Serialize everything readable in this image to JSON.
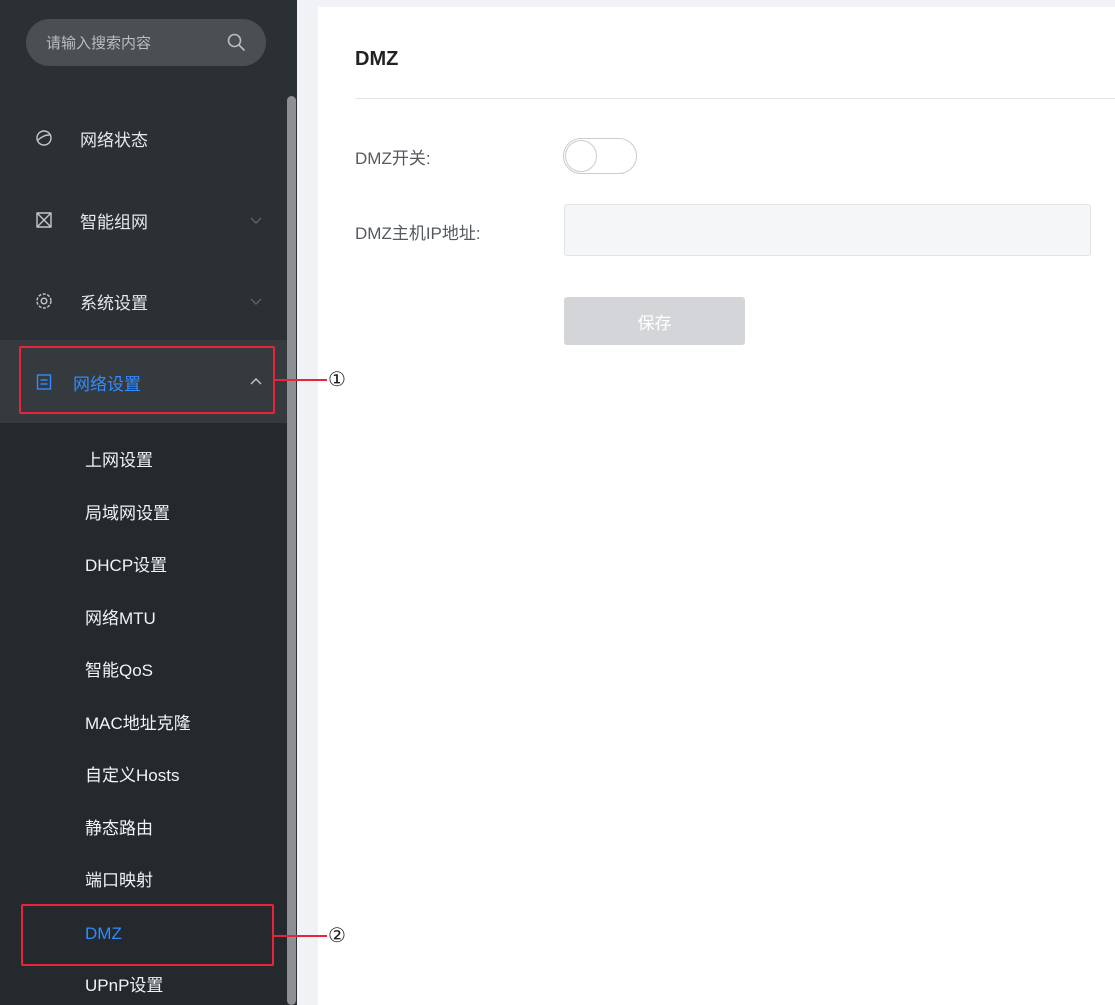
{
  "sidebar": {
    "search_placeholder": "请输入搜索内容",
    "items": [
      {
        "label": "网络状态",
        "icon": "globe-icon"
      },
      {
        "label": "智能组网",
        "icon": "mesh-icon"
      },
      {
        "label": "系统设置",
        "icon": "gear-icon"
      },
      {
        "label": "网络设置",
        "icon": "document-icon"
      }
    ],
    "submenu": [
      {
        "label": "上网设置"
      },
      {
        "label": "局域网设置"
      },
      {
        "label": "DHCP设置"
      },
      {
        "label": "网络MTU"
      },
      {
        "label": "智能QoS"
      },
      {
        "label": "MAC地址克隆"
      },
      {
        "label": "自定义Hosts"
      },
      {
        "label": "静态路由"
      },
      {
        "label": "端口映射"
      },
      {
        "label": "DMZ"
      },
      {
        "label": "UPnP设置"
      }
    ]
  },
  "annotations": {
    "one": "①",
    "two": "②"
  },
  "main": {
    "title": "DMZ",
    "dmz_switch_label": "DMZ开关:",
    "dmz_switch_on": false,
    "dmz_host_label": "DMZ主机IP地址:",
    "dmz_host_value": "",
    "save_label": "保存"
  },
  "colors": {
    "accent": "#2f8cff",
    "annotation": "#e8233a",
    "sidebar_bg": "#2b3034"
  }
}
